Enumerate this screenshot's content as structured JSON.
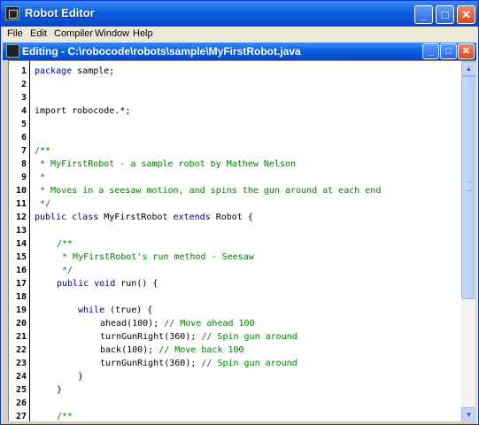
{
  "window": {
    "title": "Robot Editor",
    "buttons": {
      "minimize": "_",
      "maximize": "□",
      "close": "✕"
    }
  },
  "menu": {
    "items": [
      "File",
      "Edit",
      "Compiler",
      "Window",
      "Help"
    ]
  },
  "editor_window": {
    "title": "Editing - C:\\robocode\\robots\\sample\\MyFirstRobot.java"
  },
  "line_numbers": [
    "1",
    "2",
    "3",
    "4",
    "5",
    "6",
    "7",
    "8",
    "9",
    "10",
    "11",
    "12",
    "13",
    "14",
    "15",
    "16",
    "17",
    "18",
    "19",
    "20",
    "21",
    "22",
    "23",
    "24",
    "25",
    "26",
    "27"
  ],
  "code": {
    "l1_kw": "package",
    "l1_tx": " sample;",
    "l4_tx": "import robocode.*;",
    "l7_cm": "/**",
    "l8_cm": " * MyFirstRobot - a sample robot by Mathew Nelson",
    "l9_cm": " *",
    "l10_cm": " * Moves in a seesaw motion, and spins the gun around at each end",
    "l11_cm": " */",
    "l12_kw": "public class",
    "l12_tx": " MyFirstRobot ",
    "l12_kw2": "extends",
    "l12_tx2": " Robot {",
    "l14_cm": "/**",
    "l15_cm": " * MyFirstRobot's run method - Seesaw",
    "l16_cm": " */",
    "l17_kw": "public void",
    "l17_tx": " run() {",
    "l19_kw": "while",
    "l19_tx": " (true) {",
    "l20_tx": "ahead(100); ",
    "l20_cm": "// Move ahead 100",
    "l21_tx": "turnGunRight(360); ",
    "l21_cm": "// Spin gun around",
    "l22_tx": "back(100); ",
    "l22_cm": "// Move back 100",
    "l23_tx": "turnGunRight(360); ",
    "l23_cm": "// Spin gun around",
    "l24_tx": "}",
    "l25_tx": "}",
    "l27_cm": "/**"
  },
  "colors": {
    "keyword": "#000080",
    "comment": "#008000",
    "titlebar": "#0a5fe0"
  }
}
